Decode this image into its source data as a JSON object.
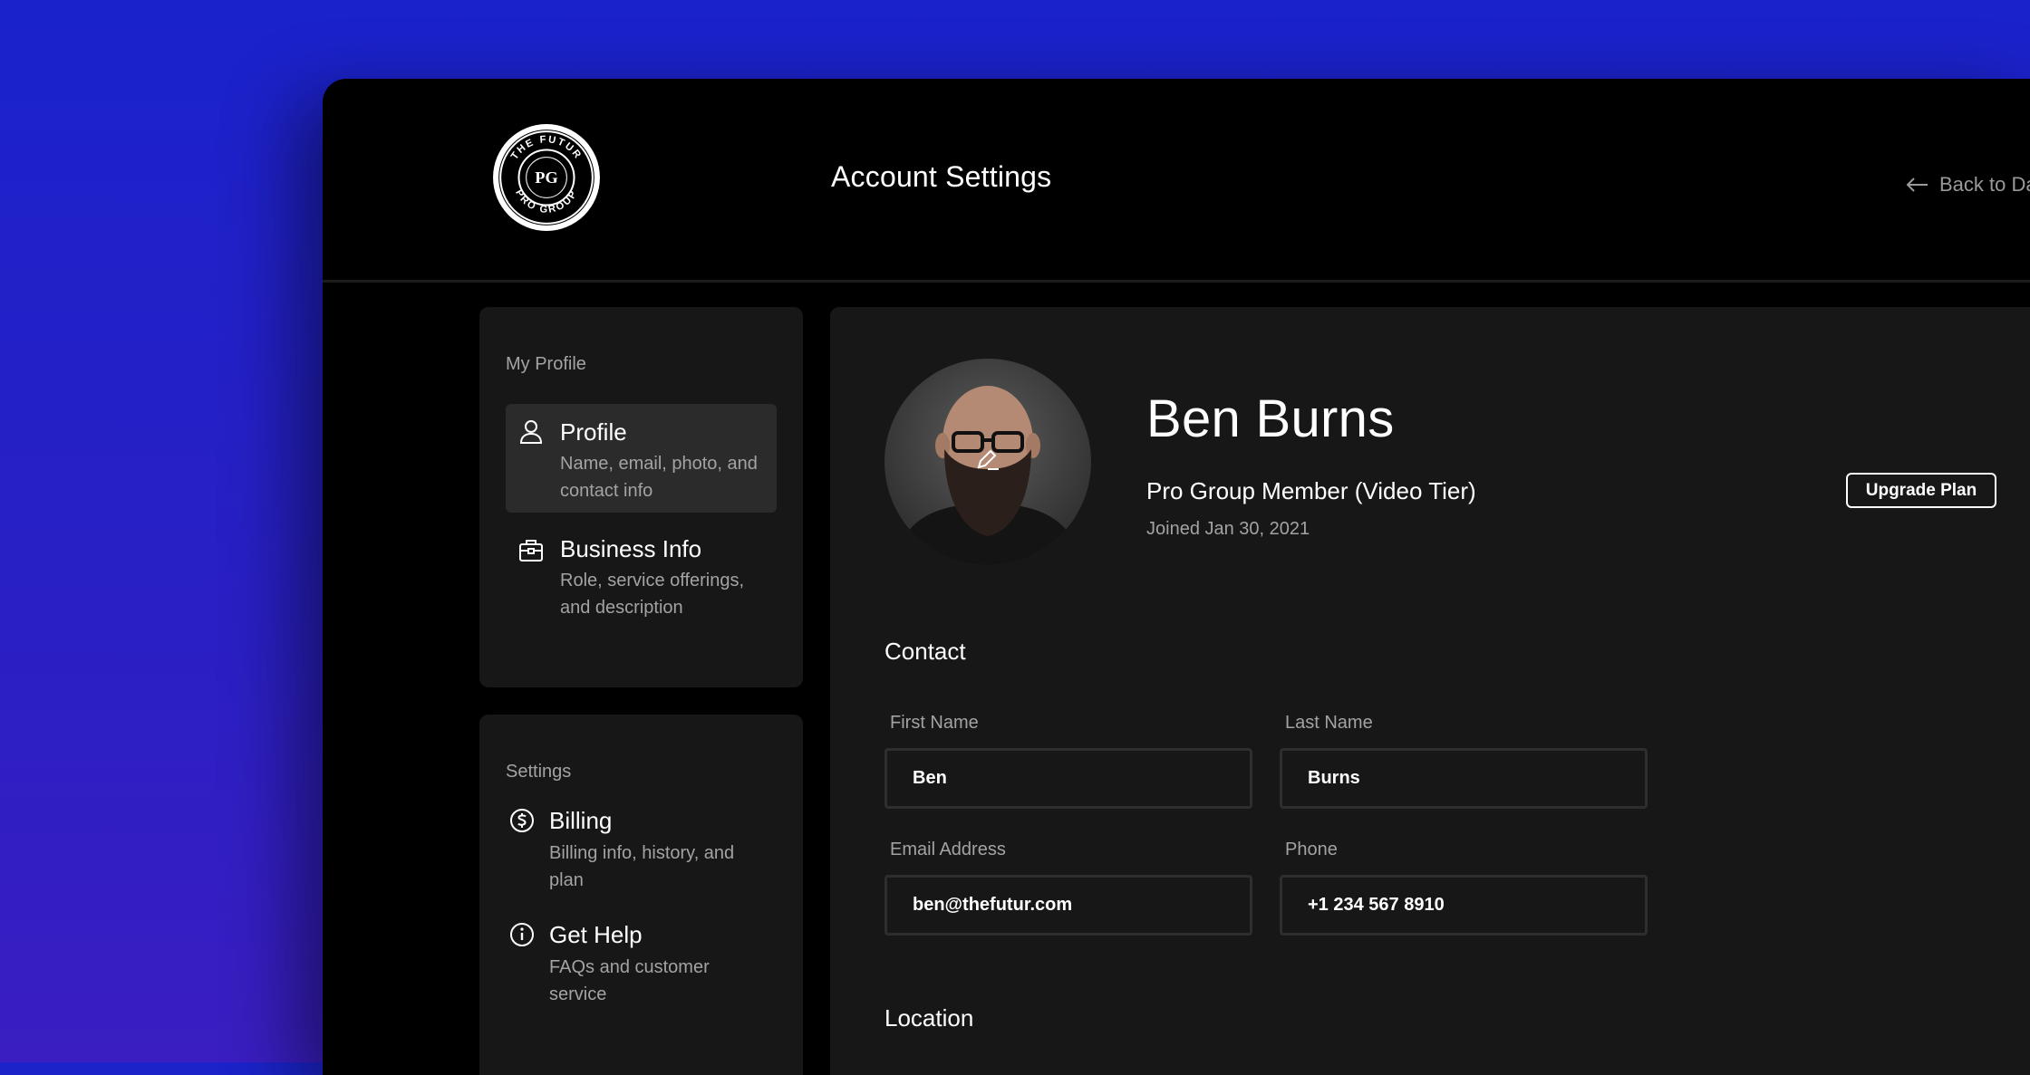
{
  "header": {
    "logo_text": "THE FUTUR PRO GROUP",
    "page_title": "Account Settings",
    "back_link": "Back to Da"
  },
  "sidebar": {
    "profile_section": {
      "label": "My Profile",
      "items": [
        {
          "title": "Profile",
          "description": "Name, email, photo, and contact info",
          "icon": "user-icon",
          "active": true
        },
        {
          "title": "Business Info",
          "description": "Role, service offerings, and description",
          "icon": "briefcase-icon",
          "active": false
        }
      ]
    },
    "settings_section": {
      "label": "Settings",
      "items": [
        {
          "title": "Billing",
          "description": "Billing info, history, and plan",
          "icon": "dollar-circle-icon"
        },
        {
          "title": "Get Help",
          "description": "FAQs and customer service",
          "icon": "info-circle-icon"
        }
      ]
    }
  },
  "profile": {
    "name": "Ben Burns",
    "membership": "Pro Group Member (Video Tier)",
    "upgrade_label": "Upgrade Plan",
    "joined": "Joined Jan 30, 2021"
  },
  "contact": {
    "heading": "Contact",
    "first_name_label": "First Name",
    "first_name_value": "Ben",
    "last_name_label": "Last Name",
    "last_name_value": "Burns",
    "email_label": "Email Address",
    "email_value": "ben@thefutur.com",
    "phone_label": "Phone",
    "phone_value": "+1 234 567 8910"
  },
  "location": {
    "heading": "Location"
  },
  "colors": {
    "background": "#1b23c9",
    "window": "#000000",
    "card": "#171717",
    "active_item": "#2b2b2b",
    "muted_text": "#a3a3a3"
  }
}
